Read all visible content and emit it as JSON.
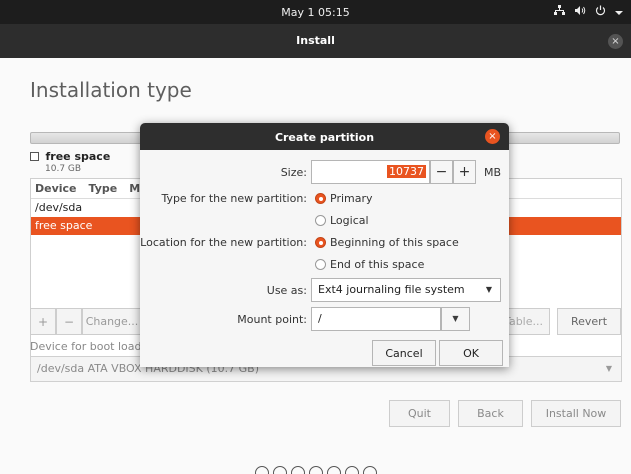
{
  "topbar": {
    "datetime": "May 1  05:15",
    "network_icon": "network-icon",
    "volume_icon": "volume-icon",
    "power_icon": "power-icon",
    "menu_icon": "chevron-down-icon"
  },
  "window": {
    "title": "Install",
    "close_glyph": "×"
  },
  "page": {
    "title": "Installation type"
  },
  "legend": {
    "name": "free space",
    "size": "10.7 GB"
  },
  "table": {
    "columns": [
      "Device",
      "Type",
      "M"
    ],
    "rows": [
      "/dev/sda",
      "free space"
    ],
    "selected_row": 1
  },
  "toolbar": {
    "add_label": "+",
    "remove_label": "−",
    "change_label": "Change...",
    "new_table_label": "Table...",
    "revert_label": "Revert"
  },
  "boot": {
    "label": "Device for boot loade",
    "value": "/dev/sda ATA VBOX HARDDISK (10.7 GB)"
  },
  "nav": {
    "quit": "Quit",
    "back": "Back",
    "install_now": "Install Now"
  },
  "progress_dots": 7,
  "dialog": {
    "title": "Create partition",
    "close_glyph": "×",
    "size_label": "Size:",
    "size_value": "10737",
    "minus": "−",
    "plus": "+",
    "unit": "MB",
    "type_label": "Type for the new partition:",
    "type_primary": "Primary",
    "type_logical": "Logical",
    "location_label": "Location for the new partition:",
    "location_begin": "Beginning of this space",
    "location_end": "End of this space",
    "useas_label": "Use as:",
    "useas_value": "Ext4 journaling file system",
    "mount_label": "Mount point:",
    "mount_value": "/",
    "cancel": "Cancel",
    "ok": "OK"
  },
  "colors": {
    "accent": "#e95420",
    "titlebar": "#2d2d2d",
    "topbar": "#1d1d1d"
  }
}
